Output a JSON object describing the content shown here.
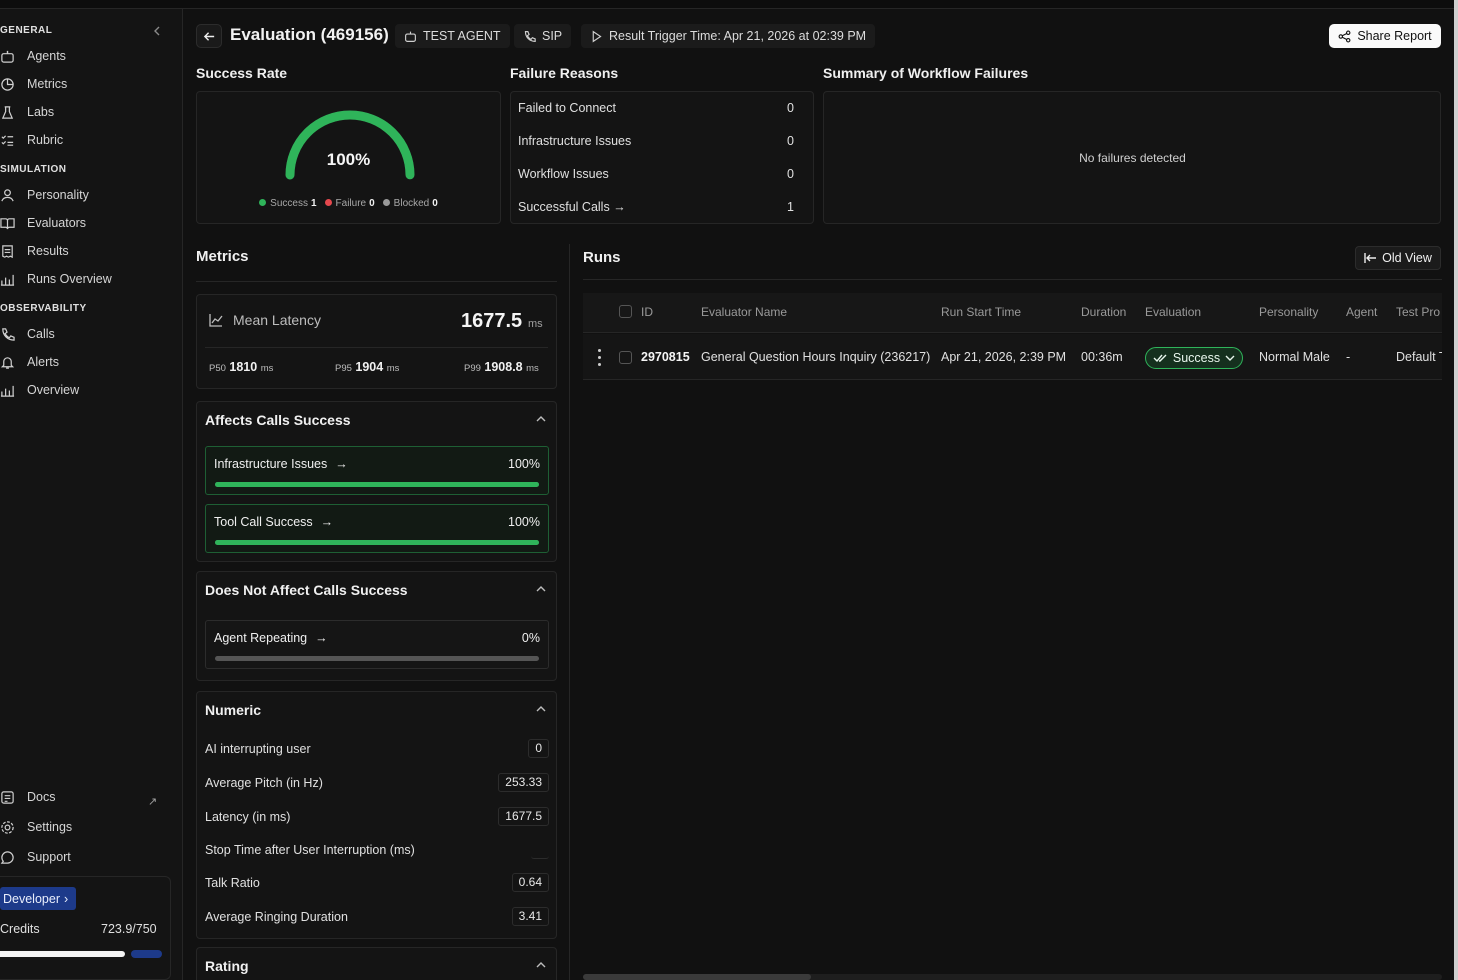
{
  "sidebar": {
    "sections": {
      "general": "GENERAL",
      "simulation": "SIMULATION",
      "observability": "OBSERVABILITY"
    },
    "general": [
      {
        "label": "Agents",
        "icon": "bot-icon"
      },
      {
        "label": "Metrics",
        "icon": "pie-chart-icon"
      },
      {
        "label": "Labs",
        "icon": "flask-icon"
      },
      {
        "label": "Rubric",
        "icon": "checklist-icon"
      }
    ],
    "simulation": [
      {
        "label": "Personality",
        "icon": "user-icon"
      },
      {
        "label": "Evaluators",
        "icon": "book-open-icon"
      },
      {
        "label": "Results",
        "icon": "receipt-icon"
      },
      {
        "label": "Runs Overview",
        "icon": "bar-chart-icon"
      }
    ],
    "observability": [
      {
        "label": "Calls",
        "icon": "phone-icon"
      },
      {
        "label": "Alerts",
        "icon": "bell-icon"
      },
      {
        "label": "Overview",
        "icon": "bar-chart-icon"
      }
    ],
    "bottom": [
      {
        "label": "Docs",
        "icon": "doc-icon"
      },
      {
        "label": "Settings",
        "icon": "gear-icon"
      },
      {
        "label": "Support",
        "icon": "chat-icon"
      }
    ],
    "developer_label": "Developer",
    "credits_label": "Credits",
    "credits_value": "723.9/750",
    "credits_used_fraction": 0.965
  },
  "header": {
    "title": "Evaluation (469156)",
    "agent_chip": "TEST AGENT",
    "sip_chip": "SIP",
    "trigger_chip": "Result Trigger Time: Apr 21, 2026 at 02:39 PM",
    "share_label": "Share Report"
  },
  "success_rate": {
    "title": "Success Rate",
    "value": "100%",
    "fraction": 1.0,
    "legend": [
      {
        "label": "Success",
        "count": "1",
        "color": "#2fb45a"
      },
      {
        "label": "Failure",
        "count": "0",
        "color": "#e5484d"
      },
      {
        "label": "Blocked",
        "count": "0",
        "color": "#9a9a9a"
      }
    ]
  },
  "failure_reasons": {
    "title": "Failure Reasons",
    "rows": [
      {
        "label": "Failed to Connect",
        "value": "0"
      },
      {
        "label": "Infrastructure Issues",
        "value": "0"
      },
      {
        "label": "Workflow Issues",
        "value": "0"
      },
      {
        "label": "Successful Calls",
        "value": "1"
      }
    ]
  },
  "workflow_summary": {
    "title": "Summary of Workflow Failures",
    "empty_text": "No failures detected"
  },
  "metrics": {
    "title": "Metrics",
    "latency": {
      "label": "Mean Latency",
      "value": "1677.5",
      "unit": "ms",
      "p50_label": "P50",
      "p50": "1810",
      "p95_label": "P95",
      "p95": "1904",
      "p99_label": "P99",
      "p99": "1908.8",
      "p_unit": "ms"
    },
    "affects": {
      "title": "Affects Calls Success",
      "items": [
        {
          "label": "Infrastructure Issues",
          "value": "100%",
          "fraction": 1.0
        },
        {
          "label": "Tool Call Success",
          "value": "100%",
          "fraction": 1.0
        }
      ]
    },
    "not_affects": {
      "title": "Does Not Affect Calls Success",
      "items": [
        {
          "label": "Agent Repeating",
          "value": "0%",
          "fraction": 0.0
        }
      ]
    },
    "numeric": {
      "title": "Numeric",
      "rows": [
        {
          "label": "AI interrupting user",
          "value": "0"
        },
        {
          "label": "Average Pitch (in Hz)",
          "value": "253.33"
        },
        {
          "label": "Latency (in ms)",
          "value": "1677.5"
        },
        {
          "label": "Stop Time after User Interruption (ms)",
          "value": ""
        },
        {
          "label": "Talk Ratio",
          "value": "0.64"
        },
        {
          "label": "Average Ringing Duration",
          "value": "3.41"
        }
      ]
    },
    "rating_title": "Rating"
  },
  "runs": {
    "title": "Runs",
    "old_view_label": "Old View",
    "columns": [
      "ID",
      "Evaluator Name",
      "Run Start Time",
      "Duration",
      "Evaluation",
      "Personality",
      "Agent",
      "Test Pro"
    ],
    "rows": [
      {
        "id": "2970815",
        "evaluator": "General Question Hours Inquiry (236217)",
        "start": "Apr 21, 2026, 2:39 PM",
        "duration": "00:36m",
        "evaluation": "Success",
        "personality": "Normal Male",
        "agent": "-",
        "test_profile": "Default T"
      }
    ]
  }
}
